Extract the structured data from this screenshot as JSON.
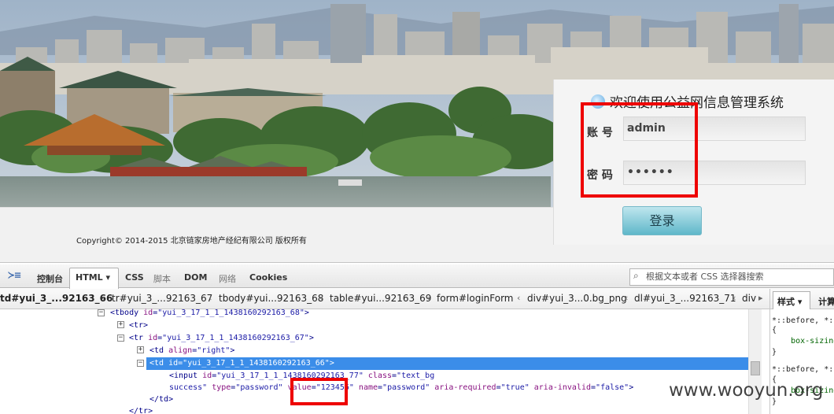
{
  "login_page": {
    "title": "欢迎使用公益网信息管理系统",
    "account_label": "账 号",
    "account_value": "admin",
    "password_label": "密 码",
    "password_value": "••••••",
    "login_button": "登录",
    "copyright": "Copyright© 2014-2015 北京链家房地产经纪有限公司 版权所有"
  },
  "devtools": {
    "tabs": [
      {
        "label": "控制台",
        "disabled": false
      },
      {
        "label": "HTML ▾",
        "active": true
      },
      {
        "label": "CSS"
      },
      {
        "label": "脚本",
        "disabled": true
      },
      {
        "label": "DOM"
      },
      {
        "label": "网络",
        "disabled": true
      },
      {
        "label": "Cookies"
      }
    ],
    "search_placeholder": "根据文本或者 CSS 选择器搜索",
    "breadcrumbs": [
      "td#yui_3_...92163_66",
      "tr#yui_3_...92163_67",
      "tbody#yui...92163_68",
      "table#yui...92163_69",
      "form#loginForm",
      "div#yui_3...0.bg_png",
      "dl#yui_3_...92163_71",
      "div"
    ],
    "side_tabs": [
      "样式 ▾",
      "计算"
    ],
    "dom_lines": [
      {
        "parts": [
          [
            "tag",
            "<tbody "
          ],
          [
            "attr",
            "id"
          ],
          [
            "tag",
            "="
          ],
          [
            "val",
            "\"yui_3_17_1_1_1438160292163_68\""
          ],
          [
            "tag",
            ">"
          ]
        ]
      },
      {
        "parts": [
          [
            "tag",
            "<tr>"
          ]
        ]
      },
      {
        "parts": [
          [
            "tag",
            "<tr "
          ],
          [
            "attr",
            "id"
          ],
          [
            "tag",
            "="
          ],
          [
            "val",
            "\"yui_3_17_1_1_1438160292163_67\""
          ],
          [
            "tag",
            ">"
          ]
        ]
      },
      {
        "parts": [
          [
            "tag",
            "<td "
          ],
          [
            "attr",
            "align"
          ],
          [
            "tag",
            "="
          ],
          [
            "val",
            "\"right\""
          ],
          [
            "tag",
            ">"
          ]
        ]
      },
      {
        "parts": [
          [
            "tag",
            "<td "
          ],
          [
            "attr",
            "id"
          ],
          [
            "tag",
            "="
          ],
          [
            "val",
            "\"yui_3_17_1_1_1438160292163_66\""
          ],
          [
            "tag",
            ">"
          ]
        ]
      },
      {
        "parts": [
          [
            "tag",
            "<input "
          ],
          [
            "attr",
            "id"
          ],
          [
            "tag",
            "="
          ],
          [
            "val",
            "\"yui_3_17_1_1_1438160292163_77\""
          ],
          [
            "tag",
            " "
          ],
          [
            "attr",
            "class"
          ],
          [
            "tag",
            "="
          ],
          [
            "val",
            "\"text_bg"
          ]
        ]
      },
      {
        "parts": [
          [
            "val",
            "success\""
          ],
          [
            "tag",
            " "
          ],
          [
            "attr",
            "type"
          ],
          [
            "tag",
            "="
          ],
          [
            "val",
            "\"password\""
          ],
          [
            "tag",
            " "
          ],
          [
            "attr",
            "value"
          ],
          [
            "tag",
            "="
          ],
          [
            "val",
            "\"123456\""
          ],
          [
            "tag",
            " "
          ],
          [
            "attr",
            "name"
          ],
          [
            "tag",
            "="
          ],
          [
            "val",
            "\"password\""
          ],
          [
            "tag",
            " "
          ],
          [
            "attr",
            "aria-required"
          ],
          [
            "tag",
            "="
          ],
          [
            "val",
            "\"true\""
          ],
          [
            "tag",
            " "
          ],
          [
            "attr",
            "aria-invalid"
          ],
          [
            "tag",
            "="
          ],
          [
            "val",
            "\"false\""
          ],
          [
            "tag",
            ">"
          ]
        ]
      },
      {
        "parts": [
          [
            "tag",
            "</td>"
          ]
        ]
      },
      {
        "parts": [
          [
            "tag",
            "</tr>"
          ]
        ]
      }
    ],
    "css_lines": [
      "*::before, *::a",
      "{",
      "    box-sizing",
      "}",
      "*::before, *::a",
      "{",
      "    box-sizing",
      "}"
    ]
  },
  "watermark": "www.wooyun.org"
}
